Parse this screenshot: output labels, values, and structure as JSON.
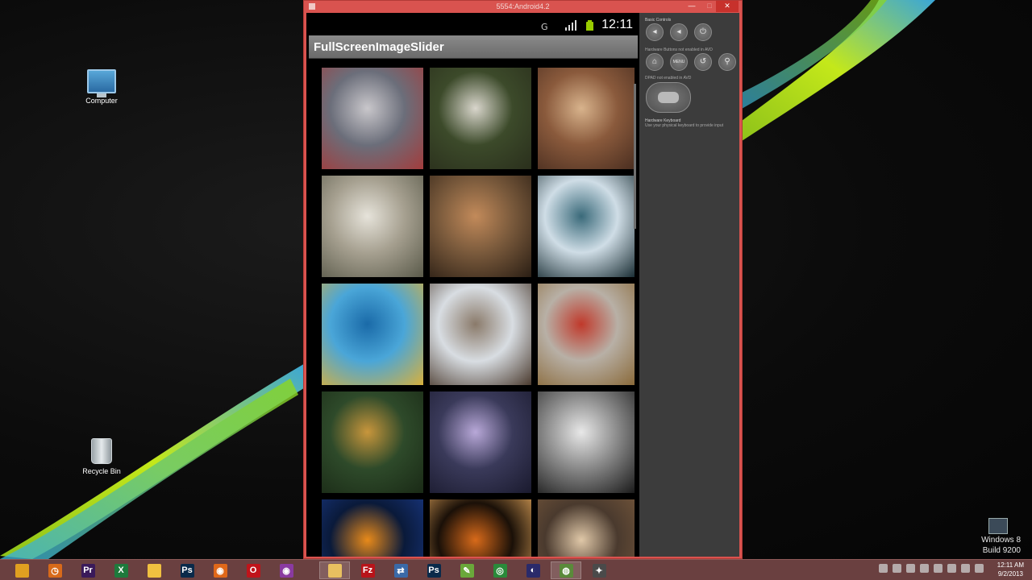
{
  "desktop": {
    "icons": [
      {
        "label": "Computer",
        "icon": "computer-icon"
      },
      {
        "label": "Recycle Bin",
        "icon": "recycle-bin-icon"
      }
    ],
    "windows_version": "Windows 8",
    "build": "Build 9200"
  },
  "emulator": {
    "title": "5554:Android4.2",
    "status_clock": "12:11",
    "app_title": "FullScreenImageSlider",
    "thumbnails": [
      {
        "subject": "face-paint-portrait",
        "colors": [
          "#6b6e7a",
          "#c9c7cb",
          "#a33c3c"
        ]
      },
      {
        "subject": "white-horse",
        "colors": [
          "#3c4a2a",
          "#d9d6cc",
          "#2a2f1c"
        ]
      },
      {
        "subject": "monkeys",
        "colors": [
          "#8a5a3c",
          "#d8b38c",
          "#4a2e20"
        ]
      },
      {
        "subject": "tree-storm",
        "colors": [
          "#a6a090",
          "#e6e3da",
          "#5a5a4a"
        ]
      },
      {
        "subject": "mustache-man",
        "colors": [
          "#7a5a3c",
          "#c28a5a",
          "#2a1e14"
        ]
      },
      {
        "subject": "diver-shark",
        "colors": [
          "#cfdde6",
          "#3a6a7a",
          "#1a2e34"
        ]
      },
      {
        "subject": "sea-dragon",
        "colors": [
          "#4aa6d8",
          "#1a6aa8",
          "#d8b03c"
        ]
      },
      {
        "subject": "owl",
        "colors": [
          "#d8dde2",
          "#8a7a6a",
          "#4a3a2e"
        ]
      },
      {
        "subject": "rooster",
        "colors": [
          "#b8b0a6",
          "#c0392b",
          "#8a6a3a"
        ]
      },
      {
        "subject": "jaguar",
        "colors": [
          "#2e4a2a",
          "#c8963c",
          "#1a2a16"
        ]
      },
      {
        "subject": "lightning",
        "colors": [
          "#3a3a5a",
          "#b8a8d8",
          "#1a1a2e"
        ]
      },
      {
        "subject": "zebras",
        "colors": [
          "#8a8a8a",
          "#e8e8e8",
          "#1a1a1a"
        ]
      },
      {
        "subject": "fire-ring",
        "colors": [
          "#0a1a3a",
          "#e88a1a",
          "#1a3a8a"
        ]
      },
      {
        "subject": "fireworks",
        "colors": [
          "#1a1008",
          "#d86a1a",
          "#f0b060"
        ]
      },
      {
        "subject": "couple",
        "colors": [
          "#4a3a2e",
          "#e0c8a8",
          "#7a5a3c"
        ]
      }
    ],
    "controls": {
      "basic_heading": "Basic Controls",
      "hw_note": "Hardware Buttons not enabled in AVD",
      "dpad_note": "DPAD not enabled in AVD",
      "kb_heading": "Hardware Keyboard",
      "kb_note": "Use your physical keyboard to provide input",
      "buttons": [
        {
          "name": "volume-down",
          "glyph": "◂"
        },
        {
          "name": "volume-up",
          "glyph": "◂"
        },
        {
          "name": "power",
          "glyph": "⏻"
        },
        {
          "name": "home",
          "glyph": "⌂"
        },
        {
          "name": "menu",
          "glyph": "MENU"
        },
        {
          "name": "back",
          "glyph": "↺"
        },
        {
          "name": "search",
          "glyph": "⚲"
        }
      ]
    }
  },
  "taskbar": {
    "items": [
      {
        "name": "explorer",
        "color": "#e0a020",
        "glyph": ""
      },
      {
        "name": "clock-app",
        "color": "#d86a1a",
        "glyph": "◷"
      },
      {
        "name": "premiere",
        "color": "#3a1a5a",
        "glyph": "Pr"
      },
      {
        "name": "excel",
        "color": "#1e7a3c",
        "glyph": "X"
      },
      {
        "name": "folder",
        "color": "#f0c040",
        "glyph": ""
      },
      {
        "name": "photoshop",
        "color": "#0a2a4a",
        "glyph": "Ps"
      },
      {
        "name": "firefox",
        "color": "#e0681a",
        "glyph": "◉"
      },
      {
        "name": "opera",
        "color": "#c0141a",
        "glyph": "O"
      },
      {
        "name": "browser-purple",
        "color": "#8a3aa0",
        "glyph": "◉"
      },
      {
        "name": "file-explorer",
        "color": "#e8c060",
        "glyph": ""
      },
      {
        "name": "filezilla",
        "color": "#b8141a",
        "glyph": "Fz"
      },
      {
        "name": "network",
        "color": "#3a6aa8",
        "glyph": "⇄"
      },
      {
        "name": "photoshop-2",
        "color": "#0a2a4a",
        "glyph": "Ps"
      },
      {
        "name": "notepad",
        "color": "#6aa83a",
        "glyph": "✎"
      },
      {
        "name": "chrome",
        "color": "#2a8a3a",
        "glyph": "◎"
      },
      {
        "name": "eclipse",
        "color": "#2a2a6a",
        "glyph": "◐"
      },
      {
        "name": "android-emulator",
        "color": "#5a8a3a",
        "glyph": "◍"
      },
      {
        "name": "sdk-manager",
        "color": "#4a4a4a",
        "glyph": "✦"
      }
    ],
    "time": "12:11 AM",
    "date": "9/2/2013"
  }
}
